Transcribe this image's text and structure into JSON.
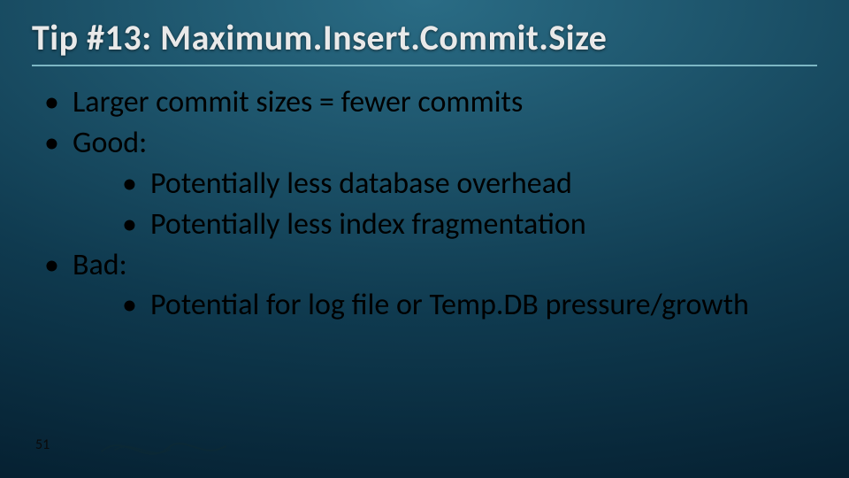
{
  "title": "Tip #13: Maximum.Insert.Commit.Size",
  "bullets": {
    "b1": "Larger commit sizes = fewer commits",
    "b2": "Good:",
    "b2a": "Potentially less database overhead",
    "b2b": "Potentially less index fragmentation",
    "b3": "Bad:",
    "b3a": "Potential for log file or Temp.DB pressure/growth"
  },
  "page_number": "51"
}
